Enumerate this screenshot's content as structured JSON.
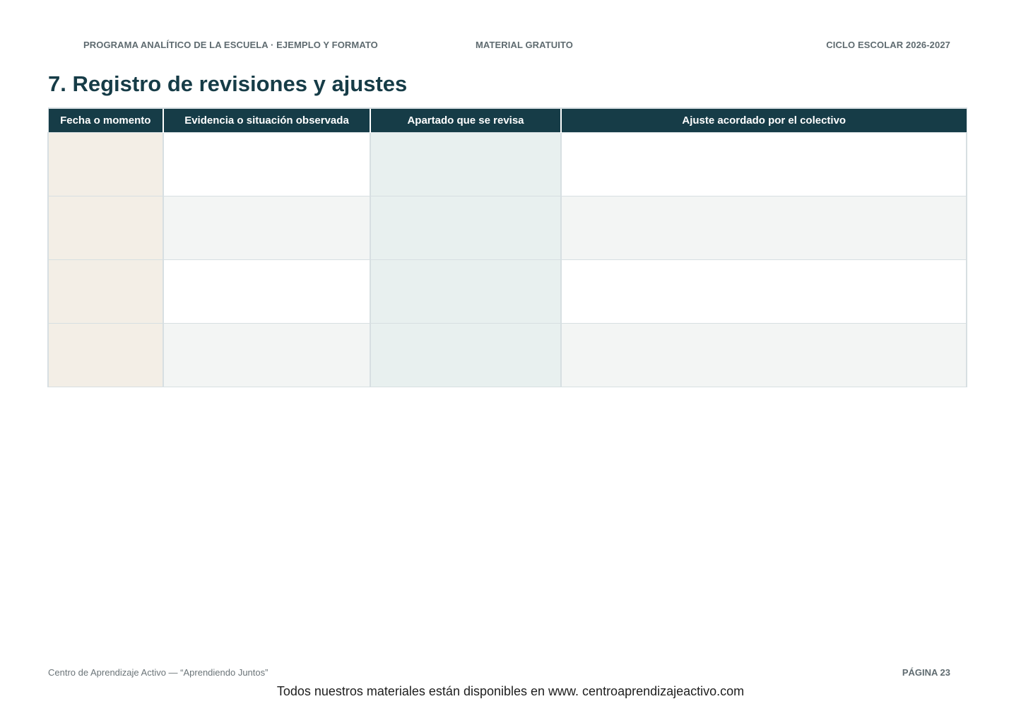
{
  "header": {
    "left": "PROGRAMA ANALÍTICO DE LA ESCUELA · EJEMPLO Y FORMATO",
    "center": "MATERIAL GRATUITO",
    "right": "CICLO ESCOLAR 2026-2027"
  },
  "section": {
    "title": "7. Registro de revisiones y ajustes"
  },
  "table": {
    "columns": [
      "Fecha o momento",
      "Evidencia o situación observada",
      "Apartado que se revisa",
      "Ajuste acordado por el colectivo"
    ],
    "rows": [
      [
        "",
        "",
        "",
        ""
      ],
      [
        "",
        "",
        "",
        ""
      ],
      [
        "",
        "",
        "",
        ""
      ],
      [
        "",
        "",
        "",
        ""
      ]
    ]
  },
  "footer": {
    "left": "Centro de Aprendizaje Activo — “Aprendiendo Juntos”",
    "page": "PÁGINA 23",
    "note": "Todos nuestros materiales están disponibles en www. centroaprendizajeactivo.com"
  },
  "colors": {
    "header_bg": "#163c47",
    "title_text": "#163c47",
    "fecha_column_bg": "#f3eee6",
    "apartado_column_bg": "#e8f0ef",
    "alt_row_bg": "#f3f5f4"
  }
}
